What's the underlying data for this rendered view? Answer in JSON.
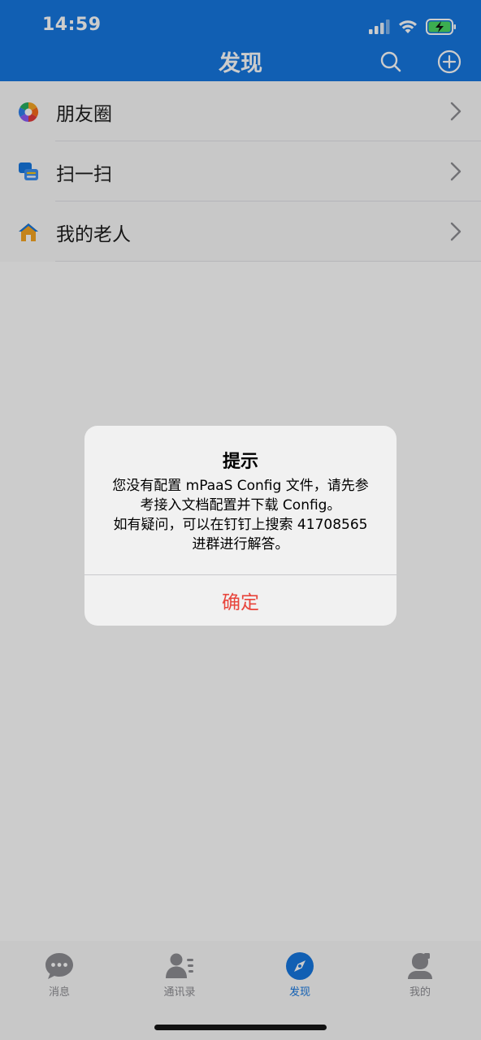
{
  "status_bar": {
    "time": "14:59"
  },
  "header": {
    "title": "发现"
  },
  "list": {
    "items": [
      {
        "label": "朋友圈",
        "icon": "aperture-icon"
      },
      {
        "label": "扫一扫",
        "icon": "scan-icon"
      },
      {
        "label": "我的老人",
        "icon": "home-icon"
      }
    ]
  },
  "tabbar": {
    "tabs": [
      {
        "label": "消息",
        "icon": "chat-bubble-icon"
      },
      {
        "label": "通讯录",
        "icon": "contacts-icon"
      },
      {
        "label": "发现",
        "icon": "compass-icon"
      },
      {
        "label": "我的",
        "icon": "person-icon"
      }
    ],
    "active_index": 2
  },
  "alert": {
    "title": "提示",
    "message_lines": [
      "您没有配置 mPaaS Config 文件，请先参",
      "考接入文档配置并下载 Config。",
      "如有疑问，可以在钉钉上搜索 41708565",
      "进群进行解答。"
    ],
    "button_label": "确定"
  },
  "colors": {
    "header": "#1677e0",
    "accent": "#1677e0",
    "alert_button": "#e8453c",
    "battery": "#4cd964"
  }
}
